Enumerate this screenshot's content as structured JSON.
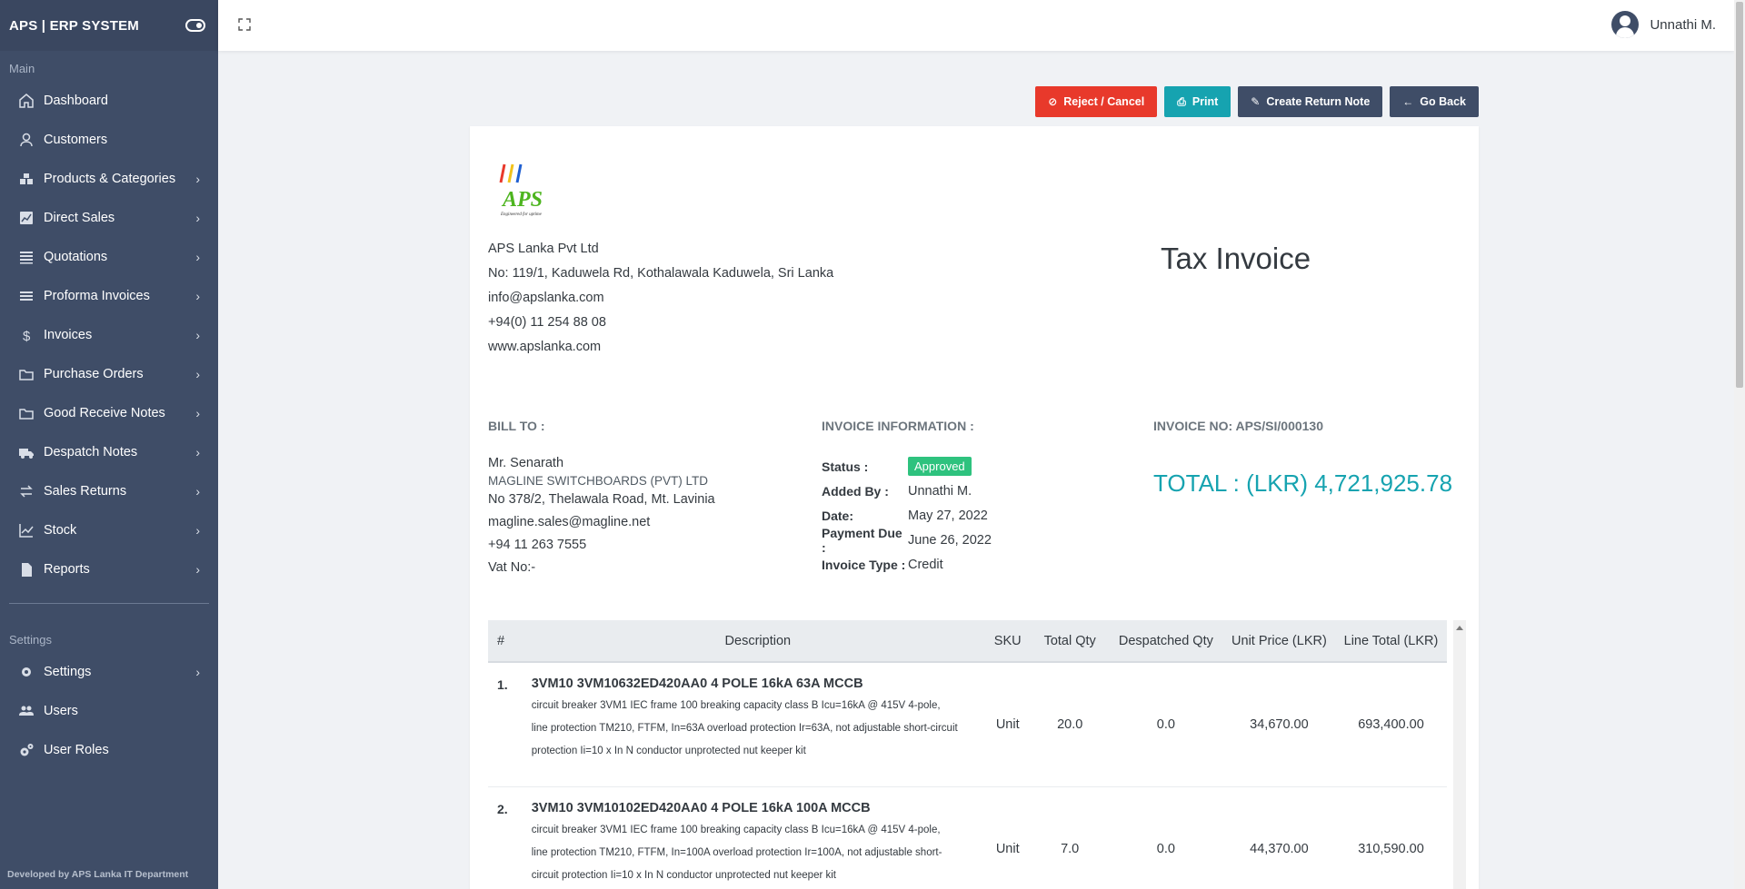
{
  "sidebar": {
    "brand": "APS | ERP SYSTEM",
    "main_label": "Main",
    "settings_label": "Settings",
    "main_items": [
      {
        "label": "Dashboard",
        "icon": "home-icon",
        "has_children": false
      },
      {
        "label": "Customers",
        "icon": "user-icon",
        "has_children": false
      },
      {
        "label": "Products & Categories",
        "icon": "cubes-icon",
        "has_children": true
      },
      {
        "label": "Direct Sales",
        "icon": "chart-area-icon",
        "has_children": true
      },
      {
        "label": "Quotations",
        "icon": "list-icon",
        "has_children": true
      },
      {
        "label": "Proforma Invoices",
        "icon": "bars-icon",
        "has_children": true
      },
      {
        "label": "Invoices",
        "icon": "dollar-icon",
        "has_children": true
      },
      {
        "label": "Purchase Orders",
        "icon": "folder-open-icon",
        "has_children": true
      },
      {
        "label": "Good Receive Notes",
        "icon": "folder-open-icon",
        "has_children": true
      },
      {
        "label": "Despatch Notes",
        "icon": "truck-icon",
        "has_children": true
      },
      {
        "label": "Sales Returns",
        "icon": "exchange-icon",
        "has_children": true
      },
      {
        "label": "Stock",
        "icon": "line-chart-icon",
        "has_children": true
      },
      {
        "label": "Reports",
        "icon": "file-icon",
        "has_children": true
      }
    ],
    "settings_items": [
      {
        "label": "Settings",
        "icon": "gear-icon",
        "has_children": true
      },
      {
        "label": "Users",
        "icon": "users-icon",
        "has_children": false
      },
      {
        "label": "User Roles",
        "icon": "gears-icon",
        "has_children": false
      }
    ],
    "footer": "Developed by APS Lanka IT Department"
  },
  "header": {
    "user_name": "Unnathi M."
  },
  "actions": {
    "reject": "Reject / Cancel",
    "print": "Print",
    "return_note": "Create Return Note",
    "go_back": "Go Back"
  },
  "invoice": {
    "title": "Tax Invoice",
    "logo_text": "APS",
    "logo_tagline": "Engineered for uptime",
    "company": {
      "name": "APS Lanka Pvt Ltd",
      "address": "No: 119/1, Kaduwela Rd, Kothalawala Kaduwela, Sri Lanka",
      "email": "info@apslanka.com",
      "phone": "+94(0) 11 254 88 08",
      "web": "www.apslanka.com"
    },
    "bill_to_label": "BILL TO :",
    "bill_to": {
      "contact": "Mr. Senarath",
      "company": "MAGLINE SWITCHBOARDS (PVT) LTD",
      "address": "No 378/2, Thelawala Road, Mt. Lavinia",
      "email": "magline.sales@magline.net",
      "phone": "+94 11 263 7555",
      "vat": "Vat No:-"
    },
    "info_label": "INVOICE INFORMATION :",
    "info": {
      "status_key": "Status :",
      "status": "Approved",
      "added_by_key": "Added By :",
      "added_by": "Unnathi M.",
      "date_key": "Date:",
      "date": "May 27, 2022",
      "due_key": "Payment Due :",
      "due": "June 26, 2022",
      "type_key": "Invoice Type :",
      "type": "Credit"
    },
    "invoice_no": "INVOICE NO: APS/SI/000130",
    "total": "TOTAL : (LKR) 4,721,925.78",
    "status_color": "#2ec27e",
    "total_color": "#16a3b0"
  },
  "table": {
    "headers": [
      "#",
      "Description",
      "SKU",
      "Total Qty",
      "Despatched Qty",
      "Unit Price (LKR)",
      "Line Total (LKR)"
    ],
    "rows": [
      {
        "num": "1.",
        "title": "3VM10 3VM10632ED420AA0 4 POLE 16kA 63A MCCB",
        "desc": "circuit breaker 3VM1 IEC frame 100 breaking capacity class B Icu=16kA @ 415V 4-pole, line protection TM210, FTFM, In=63A overload protection Ir=63A, not adjustable short-circuit protection Ii=10 x In N conductor unprotected nut keeper kit",
        "sku": "Unit",
        "qty": "20.0",
        "despatched": "0.0",
        "unit_price": "34,670.00",
        "line_total": "693,400.00"
      },
      {
        "num": "2.",
        "title": "3VM10 3VM10102ED420AA0 4 POLE 16kA 100A MCCB",
        "desc": "circuit breaker 3VM1 IEC frame 100 breaking capacity class B Icu=16kA @ 415V 4-pole, line protection TM210, FTFM, In=100A overload protection Ir=100A, not adjustable short-circuit protection Ii=10 x In N conductor unprotected nut keeper kit",
        "sku": "Unit",
        "qty": "7.0",
        "despatched": "0.0",
        "unit_price": "44,370.00",
        "line_total": "310,590.00"
      }
    ]
  },
  "colors": {
    "sidebar": "#3f4d67",
    "reject": "#e8392b",
    "print": "#16a3b0",
    "dark_button": "#3f4d67"
  }
}
